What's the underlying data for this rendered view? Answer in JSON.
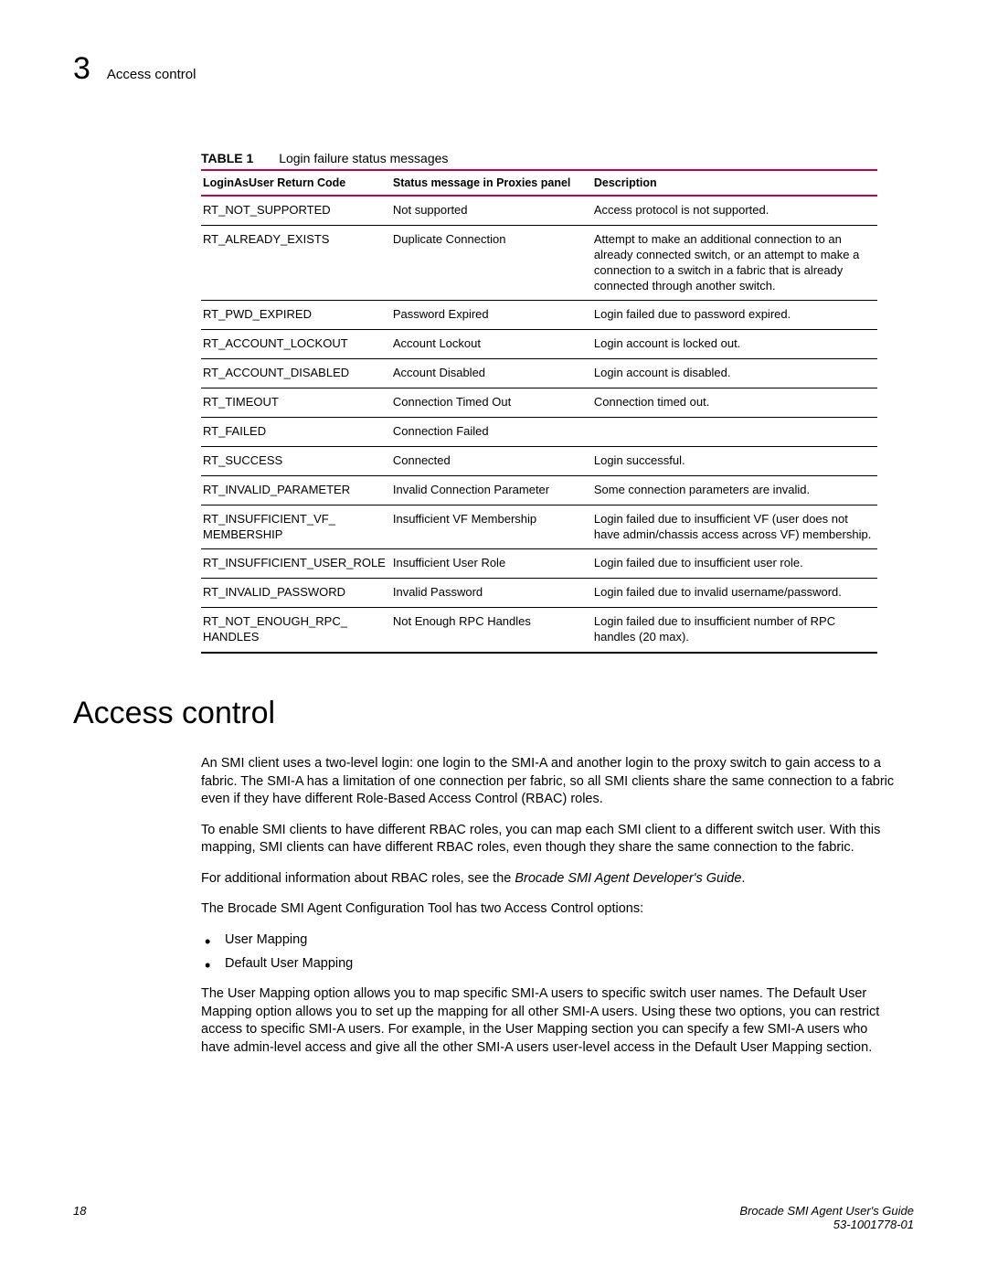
{
  "header": {
    "chapter_number": "3",
    "title": "Access control"
  },
  "table": {
    "label": "TABLE 1",
    "caption": "Login failure status messages",
    "columns": [
      "LoginAsUser Return Code",
      "Status message in Proxies panel",
      "Description"
    ],
    "rows": [
      {
        "code": "RT_NOT_SUPPORTED",
        "msg": "Not supported",
        "desc": "Access protocol is not supported."
      },
      {
        "code": "RT_ALREADY_EXISTS",
        "msg": "Duplicate Connection",
        "desc": "Attempt to make an additional connection to an already connected switch, or an attempt to make a connection to a switch in a fabric that is already connected through another switch."
      },
      {
        "code": "RT_PWD_EXPIRED",
        "msg": "Password Expired",
        "desc": "Login failed due to password expired."
      },
      {
        "code": "RT_ACCOUNT_LOCKOUT",
        "msg": "Account Lockout",
        "desc": "Login account is locked out."
      },
      {
        "code": "RT_ACCOUNT_DISABLED",
        "msg": "Account Disabled",
        "desc": "Login account is disabled."
      },
      {
        "code": "RT_TIMEOUT",
        "msg": "Connection Timed Out",
        "desc": "Connection timed out."
      },
      {
        "code": "RT_FAILED",
        "msg": "Connection Failed",
        "desc": ""
      },
      {
        "code": "RT_SUCCESS",
        "msg": "Connected",
        "desc": "Login successful."
      },
      {
        "code": "RT_INVALID_PARAMETER",
        "msg": "Invalid Connection Parameter",
        "desc": "Some connection parameters are invalid."
      },
      {
        "code": "RT_INSUFFICIENT_VF_ MEMBERSHIP",
        "msg": "Insufficient VF Membership",
        "desc": "Login failed due to insufficient VF (user does not have admin/chassis access across VF) membership."
      },
      {
        "code": "RT_INSUFFICIENT_USER_ROLE",
        "msg": "Insufficient User Role",
        "desc": "Login failed due to insufficient user role."
      },
      {
        "code": "RT_INVALID_PASSWORD",
        "msg": "Invalid Password",
        "desc": "Login failed due to invalid username/password."
      },
      {
        "code": "RT_NOT_ENOUGH_RPC_ HANDLES",
        "msg": "Not Enough RPC Handles",
        "desc": "Login failed due to insufficient number of RPC handles (20 max)."
      }
    ]
  },
  "section": {
    "heading": "Access control",
    "p1": "An SMI client uses a two-level login: one login to the SMI-A and another login to the proxy switch to gain access to a fabric. The SMI-A has a limitation of one connection per fabric, so all SMI clients share the same connection to a fabric even if they have different Role-Based Access Control (RBAC) roles.",
    "p2": "To enable SMI clients to have different RBAC roles, you can map each SMI client to a different switch user. With this mapping, SMI clients can have different RBAC roles, even though they share the same connection to the fabric.",
    "p3_pre": "For additional information about RBAC roles, see the ",
    "p3_em": "Brocade SMI Agent Developer's Guide",
    "p3_post": ".",
    "p4": "The Brocade SMI Agent Configuration Tool has two Access Control options:",
    "bullets": [
      "User Mapping",
      "Default User Mapping"
    ],
    "p5": "The User Mapping option allows you to map specific SMI-A users to specific switch user names. The Default User Mapping option allows you to set up the mapping for all other SMI-A users. Using these two options, you can restrict access to specific SMI-A users. For example, in the User Mapping section you can specify a few SMI-A users who have admin-level access and give all the other SMI-A users user-level access in the Default User Mapping section."
  },
  "footer": {
    "page": "18",
    "doc_title": "Brocade SMI Agent User's Guide",
    "doc_id": "53-1001778-01"
  }
}
